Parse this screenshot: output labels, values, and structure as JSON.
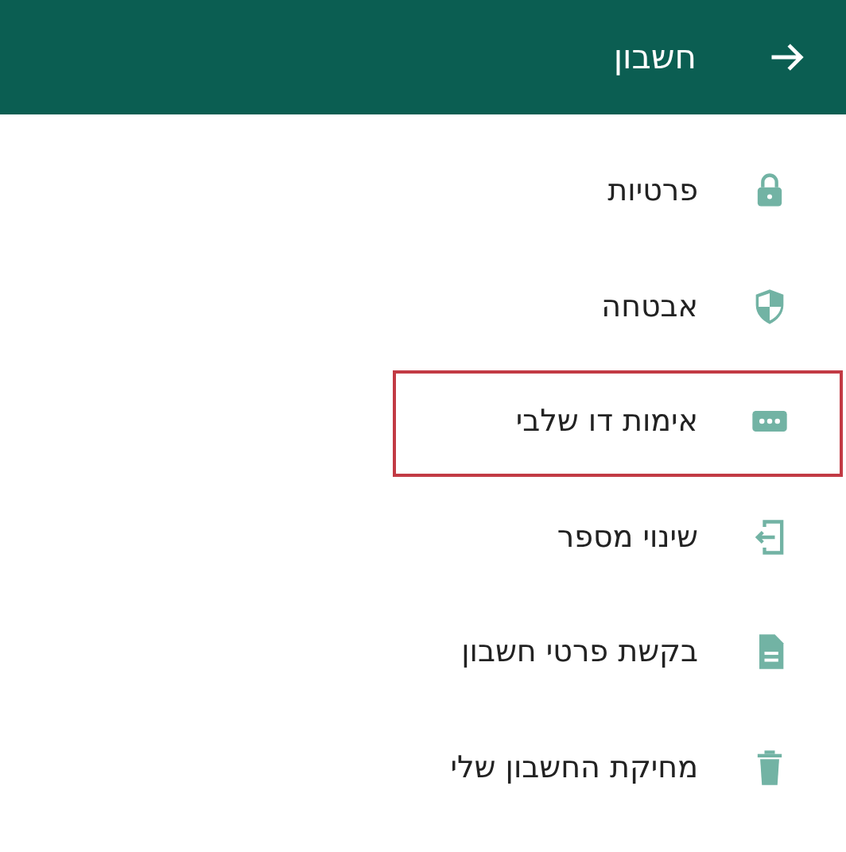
{
  "header": {
    "title": "חשבון"
  },
  "items": [
    {
      "label": "פרטיות",
      "highlighted": false
    },
    {
      "label": "אבטחה",
      "highlighted": false
    },
    {
      "label": "אימות דו שלבי",
      "highlighted": true
    },
    {
      "label": "שינוי מספר",
      "highlighted": false
    },
    {
      "label": "בקשת פרטי חשבון",
      "highlighted": false
    },
    {
      "label": "מחיקת החשבון שלי",
      "highlighted": false
    }
  ]
}
